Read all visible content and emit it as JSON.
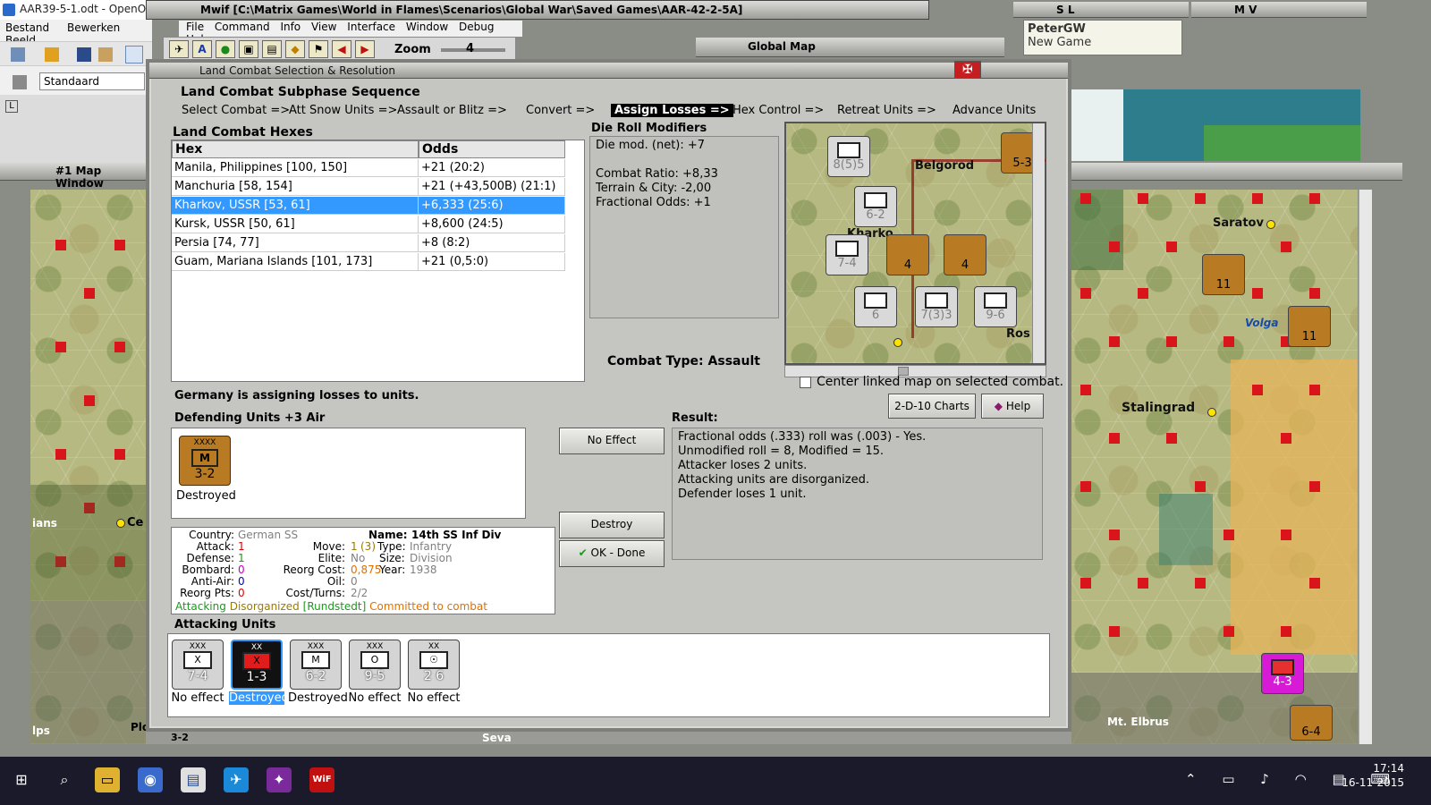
{
  "openoffice": {
    "title": "AAR39-5-1.odt - OpenOffice",
    "menu": [
      "Bestand",
      "Bewerken",
      "Beeld"
    ],
    "style_value": "Standaard"
  },
  "mwif": {
    "title": "Mwif [C:\\Matrix Games\\World in Flames\\Scenarios\\Global War\\Saved Games\\AAR-42-2-5A]",
    "menu": [
      "File",
      "Command",
      "Info",
      "View",
      "Interface",
      "Window",
      "Debug",
      "Help"
    ],
    "zoom_label": "Zoom",
    "zoom_value": "4"
  },
  "windows": {
    "map1_title": "#1 Map Window",
    "global_map_title": "Global Map",
    "sl_label": "S L",
    "mv_label": "M V",
    "player_name": "PeterGW",
    "player_status": "New Game"
  },
  "dialog": {
    "title": "Land Combat Selection & Resolution",
    "sequence_heading": "Land Combat Subphase Sequence",
    "sequence": [
      {
        "label": "Select Combat =>",
        "active": false
      },
      {
        "label": "Att Snow Units =>",
        "active": false
      },
      {
        "label": "Assault or Blitz =>",
        "active": false
      },
      {
        "label": "Convert =>",
        "active": false
      },
      {
        "label": "Assign Losses =>",
        "active": true
      },
      {
        "label": "Hex Control =>",
        "active": false
      },
      {
        "label": "Retreat Units =>",
        "active": false
      },
      {
        "label": "Advance Units",
        "active": false
      }
    ],
    "hexes_heading": "Land Combat Hexes",
    "hex_columns": [
      "Hex",
      "Odds"
    ],
    "hexes": [
      {
        "hex": "Manila, Philippines [100, 150]",
        "odds": "+21 (20:2)",
        "selected": false
      },
      {
        "hex": "Manchuria [58, 154]",
        "odds": "+21 (+43,500B) (21:1)",
        "selected": false
      },
      {
        "hex": "Kharkov, USSR [53, 61]",
        "odds": "+6,333 (25:6)",
        "selected": true
      },
      {
        "hex": "Kursk, USSR [50, 61]",
        "odds": "+8,600 (24:5)",
        "selected": false
      },
      {
        "hex": "Persia [74, 77]",
        "odds": "+8 (8:2)",
        "selected": false
      },
      {
        "hex": "Guam, Mariana Islands [101, 173]",
        "odds": "+21 (0,5:0)",
        "selected": false
      }
    ],
    "drm_heading": "Die Roll Modifiers",
    "drm_lines": [
      "Die mod. (net): +7",
      "",
      "Combat Ratio: +8,33",
      "Terrain & City: -2,00",
      "Fractional Odds: +1"
    ],
    "combat_type_label": "Combat Type:",
    "combat_type_value": "Assault",
    "center_checkbox_label": "Center linked map on selected combat.",
    "charts_button": "2-D-10 Charts",
    "help_button": "Help",
    "assign_msg": "Germany is assigning losses to units.",
    "defending_heading": "Defending Units +3 Air",
    "defender": {
      "size": "XXXX",
      "type": "M",
      "value": "3-2",
      "status": "Destroyed"
    },
    "buttons": {
      "no_effect": "No Effect",
      "destroy": "Destroy",
      "ok_done": "OK - Done"
    },
    "result_heading": "Result:",
    "result_lines": [
      "Fractional odds (.333) roll was (.003)  - Yes.",
      "Unmodified roll = 8, Modified = 15.",
      "Attacker loses 2 units.",
      "Attacking units are disorganized.",
      "Defender loses 1 unit."
    ],
    "unit_info": {
      "country_label": "Country:",
      "country": "German SS",
      "name_label": "Name:",
      "name": "14th SS Inf Div",
      "attack_label": "Attack:",
      "attack": "1",
      "move_label": "Move:",
      "move_a": "1",
      "move_b": "(3)",
      "type_label": "Type:",
      "type": "Infantry",
      "defense_label": "Defense:",
      "defense": "1",
      "elite_label": "Elite:",
      "elite": "No",
      "size_label": "Size:",
      "size": "Division",
      "bombard_label": "Bombard:",
      "bombard": "0",
      "reorg_cost_label": "Reorg Cost:",
      "reorg_cost": "0,875",
      "year_label": "Year:",
      "year": "1938",
      "aa_label": "Anti-Air:",
      "aa": "0",
      "oil_label": "Oil:",
      "oil": "0",
      "reorg_pts_label": "Reorg Pts:",
      "reorg_pts": "0",
      "cost_turns_label": "Cost/Turns:",
      "cost_turns": "2/2",
      "status_attacking": "Attacking",
      "status_disorganized": "Disorganized",
      "status_commander": "[Rundstedt]",
      "status_committed": "Committed to combat"
    },
    "attacking_heading": "Attacking Units",
    "attackers": [
      {
        "size": "XXX",
        "type": "X",
        "value": "7-4",
        "status": "No effect",
        "selected": false
      },
      {
        "size": "XX",
        "type": "X",
        "value": "1-3",
        "status": "Destroyed",
        "selected": true
      },
      {
        "size": "XXX",
        "type": "M",
        "value": "6-2",
        "status": "Destroyed",
        "selected": false
      },
      {
        "size": "XXX",
        "type": "O",
        "value": "9-5",
        "status": "No effect",
        "selected": false
      },
      {
        "size": "XX",
        "type": "☉",
        "value": "2 6",
        "status": "No effect",
        "selected": false
      }
    ]
  },
  "mini_map_labels": {
    "city1": "Belgorod",
    "city2": "Kharko",
    "city3": "Ros"
  },
  "mini_map_counters": [
    "8(5)5",
    "6-2",
    "7-4",
    "4",
    "4",
    "6",
    "7(3)3",
    "9-6",
    "5-3"
  ],
  "right_map_labels": {
    "saratov": "Saratov",
    "volga": "Volga",
    "stalingrad": "Stalingrad",
    "elbrus": "Mt. Elbrus"
  },
  "right_map_counters": [
    "11",
    "11",
    "4-3",
    "6-4"
  ],
  "left_map_labels": {
    "ce": "Ce",
    "ians": "ians",
    "lps": "lps",
    "plo": "Plo"
  },
  "bottom_strip": {
    "left_value": "3-2",
    "seva": "Seva"
  },
  "taskbar": {
    "time": "17:14",
    "date": "16-11-2015"
  }
}
